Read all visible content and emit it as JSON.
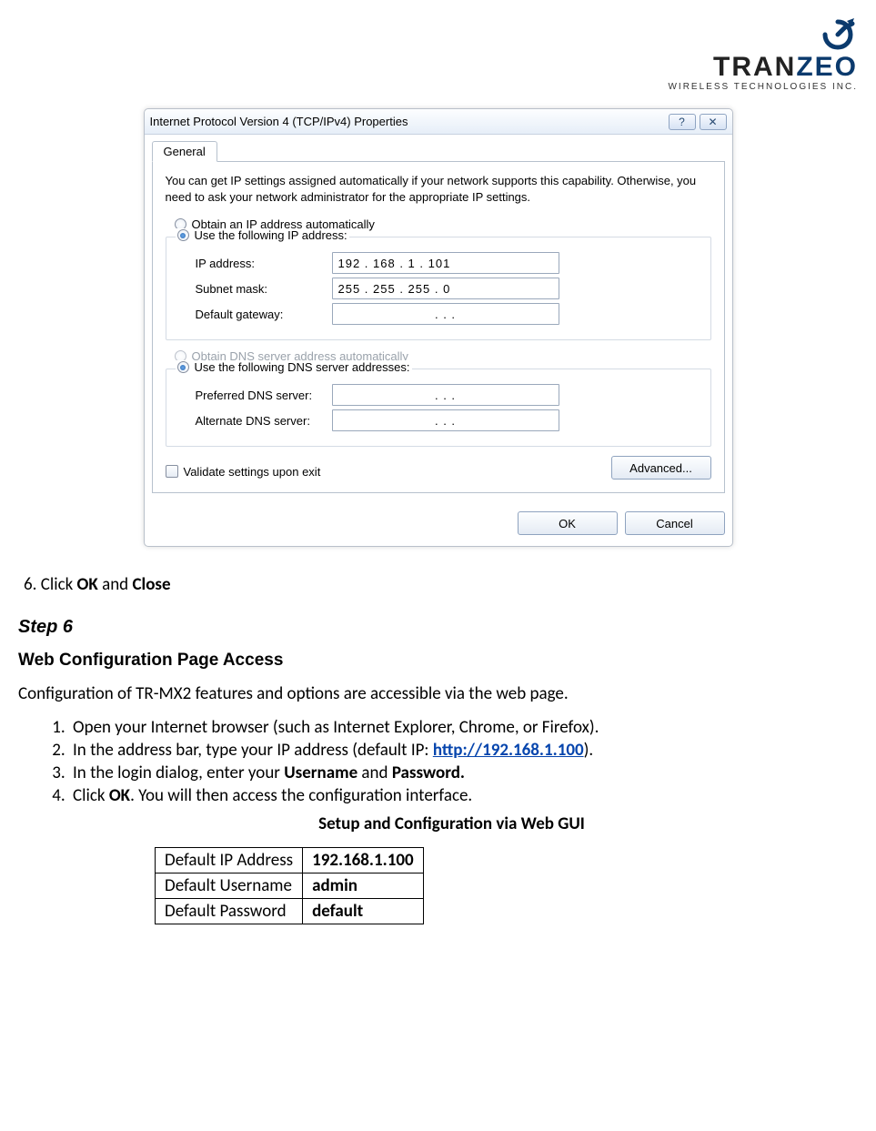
{
  "logo": {
    "text_tran": "TRAN",
    "text_zeo": "ZEO",
    "sub": "WIRELESS  TECHNOLOGIES INC."
  },
  "dialog": {
    "title": "Internet Protocol Version 4 (TCP/IPv4) Properties",
    "help_glyph": "?",
    "close_glyph": "✕",
    "tab": "General",
    "desc": "You can get IP settings assigned automatically if your network supports this capability. Otherwise, you need to ask your network administrator for the appropriate IP settings.",
    "ip_group": {
      "radio_auto": "Obtain an IP address automatically",
      "radio_manual": "Use the following IP address:",
      "labels": {
        "ip": "IP address:",
        "subnet": "Subnet mask:",
        "gateway": "Default gateway:"
      },
      "values": {
        "ip": "192 . 168 .   1   . 101",
        "subnet": "255 . 255 . 255 .  0",
        "gateway": ".          .          ."
      }
    },
    "dns_group": {
      "radio_auto": "Obtain DNS server address automatically",
      "radio_manual": "Use the following DNS server addresses:",
      "labels": {
        "pref": "Preferred DNS server:",
        "alt": "Alternate DNS server:"
      },
      "values": {
        "pref": ".          .          .",
        "alt": ".          .          ."
      }
    },
    "validate_label": "Validate settings upon exit",
    "advanced_button": "Advanced...",
    "ok_button": "OK",
    "cancel_button": "Cancel"
  },
  "doc": {
    "step6_line_prefix": "6.  Click ",
    "ok": "OK",
    "and": " and ",
    "close": "Close",
    "step_heading": "Step 6",
    "section_heading": "Web Configuration Page Access",
    "intro_para": "Configuration of TR-MX2 features and options are accessible via the web page.",
    "list": {
      "i1": "Open your Internet browser (such as Internet Explorer, Chrome, or Firefox).",
      "i2_pre": "In the address bar, type your IP address (default IP: ",
      "i2_link": "http://192.168.1.100",
      "i2_post": ").",
      "i3_pre": "In the login dialog, enter your ",
      "i3_user": "Username",
      "i3_mid": " and ",
      "i3_pass": "Password.",
      "i4_pre": "Click ",
      "i4_ok": "OK",
      "i4_post": ". You will then access the configuration interface."
    },
    "center_heading": "Setup and Configuration via Web GUI",
    "table": {
      "r1k": "Default IP Address",
      "r1v": "192.168.1.100",
      "r2k": "Default Username",
      "r2v": "admin",
      "r3k": "Default Password",
      "r3v": "default"
    }
  }
}
